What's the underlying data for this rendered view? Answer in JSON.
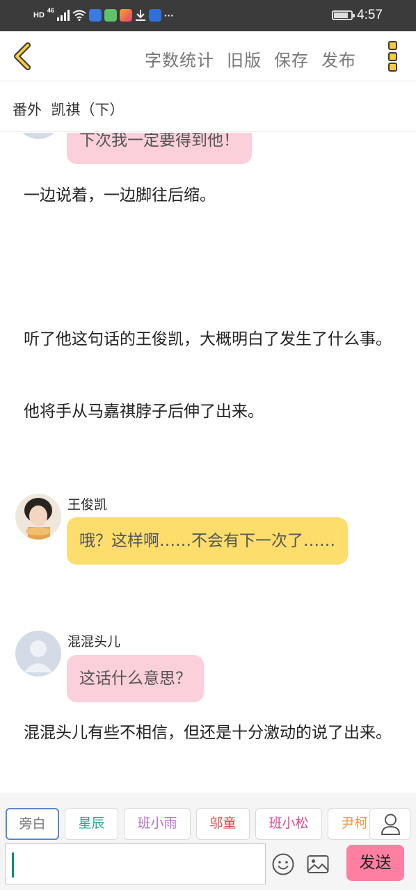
{
  "status_bar": {
    "network": "HD",
    "signal": "46",
    "time": "4:57",
    "more": "···",
    "battery_level": 0.85,
    "app_icons": [
      "blue-app-icon",
      "green-app-icon",
      "video-app-icon",
      "download-icon",
      "wifi-hotspot-icon"
    ],
    "colors": {
      "bg": "#3b3b3b"
    }
  },
  "topbar": {
    "back_icon": "chevron-left-icon",
    "actions": [
      "字数统计",
      "旧版",
      "保存",
      "发布"
    ],
    "menu_icon": "more-vertical-icon",
    "colors": {
      "accent": "#f6cc3c"
    }
  },
  "chapter": {
    "title": "番外  凯祺（下）"
  },
  "messages": [
    {
      "type": "bubble",
      "style": "pink",
      "text": "下次我一定要得到他！"
    },
    {
      "type": "narration",
      "text": "一边说着，一边脚往后缩。"
    },
    {
      "type": "narration",
      "text": "听了他这句话的王俊凯，大概明白了发生了什么事。"
    },
    {
      "type": "narration",
      "text": "他将手从马嘉祺脖子后伸了出来。"
    },
    {
      "type": "speaker",
      "name": "王俊凯"
    },
    {
      "type": "bubble",
      "style": "yellow",
      "text": "哦？这样啊……不会有下一次了……"
    },
    {
      "type": "speaker",
      "name": "混混头儿"
    },
    {
      "type": "bubble",
      "style": "pink",
      "text": "这话什么意思？"
    },
    {
      "type": "narration",
      "text": "混混头儿有些不相信，但还是十分激动的说了出来。"
    }
  ],
  "characters": [
    {
      "label": "旁白",
      "color": "#777777",
      "active": true
    },
    {
      "label": "星辰",
      "color": "#2aa596",
      "active": false
    },
    {
      "label": "班小雨",
      "color": "#b46ec8",
      "active": false
    },
    {
      "label": "邬童",
      "color": "#d64545",
      "active": false
    },
    {
      "label": "班小松",
      "color": "#d84a8a",
      "active": false
    },
    {
      "label": "尹柯",
      "color": "#ee9a4d",
      "active": false
    }
  ],
  "composer": {
    "input_value": "",
    "person_icon": "person-icon",
    "emoji_icon": "emoji-icon",
    "image_icon": "image-icon",
    "send_label": "发送",
    "colors": {
      "send": "#fe7fa0"
    }
  }
}
